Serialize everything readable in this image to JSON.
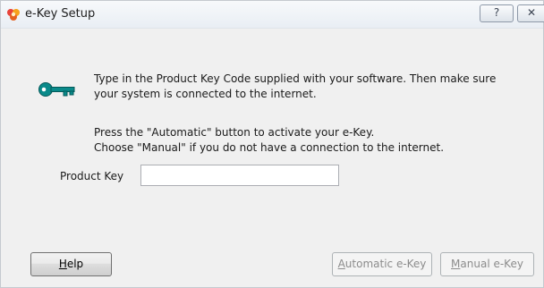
{
  "window": {
    "title": "e-Key Setup"
  },
  "titlebar": {
    "help_glyph": "?",
    "close_glyph": "✕"
  },
  "instructions": {
    "line1": "Type in the Product Key Code supplied with your software.  Then make sure",
    "line2": "your system is connected to the internet.",
    "line3": "Press the \"Automatic\" button to activate your e-Key.",
    "line4": "Choose \"Manual\" if you do not have a connection to the internet."
  },
  "product_key": {
    "label": "Product Key",
    "value": "",
    "placeholder": ""
  },
  "buttons": {
    "help": {
      "accel": "H",
      "rest": "elp"
    },
    "automatic": {
      "accel": "A",
      "rest": "utomatic e-Key"
    },
    "manual": {
      "accel": "M",
      "rest": "anual e-Key"
    }
  },
  "icons": {
    "app": "app-logo-icon",
    "key": "key-icon"
  },
  "colors": {
    "key_teal": "#0a8a8a",
    "disabled_text": "#8c8c8c"
  }
}
